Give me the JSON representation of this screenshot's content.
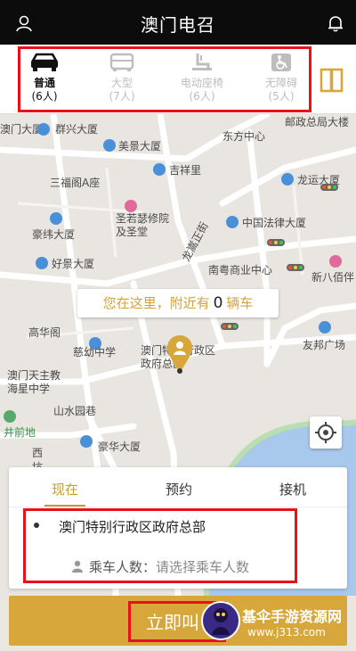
{
  "header": {
    "title": "澳门电召",
    "left_icon": "user-icon",
    "right_icon": "bell-icon"
  },
  "vehicle_types": [
    {
      "name": "普通",
      "capacity": "(6人)",
      "icon": "sedan-icon",
      "active": true
    },
    {
      "name": "大型",
      "capacity": "(7人)",
      "icon": "van-icon",
      "active": false
    },
    {
      "name": "电动座椅",
      "capacity": "(6人)",
      "icon": "power-seat-icon",
      "active": false
    },
    {
      "name": "无障碍",
      "capacity": "(5人)",
      "icon": "wheelchair-icon",
      "active": false
    }
  ],
  "map": {
    "labels": [
      "澳门大厦",
      "群兴大厦",
      "邮政总局大楼",
      "美景大厦",
      "东方中心",
      "吉祥里",
      "三福阁A座",
      "龙运大厦",
      "圣若瑟修院及圣堂",
      "龙嵩正街",
      "中国法律大厦",
      "豪纬大厦",
      "好景大厦",
      "南粤商业中心",
      "新八佰伴",
      "高华阁",
      "慈幼中学",
      "友邦广场",
      "澳门天主教海星中学",
      "山水园巷",
      "井前地",
      "豪华大厦",
      "西坑"
    ],
    "building_label": "澳门特别行政区政府总部",
    "nearby_prefix": "您在这里，附近有",
    "nearby_count": "0",
    "nearby_suffix": "辆车"
  },
  "panel": {
    "tabs": [
      "现在",
      "预约",
      "接机"
    ],
    "active_tab": "现在",
    "destination": "澳门特别行政区政府总部",
    "passenger_label": "乘车人数：",
    "passenger_placeholder": "请选择乘车人数"
  },
  "call_button": {
    "label": "立即叫"
  },
  "watermark": {
    "title": "基伞手游资源网",
    "url": "www.j313.com"
  },
  "colors": {
    "accent": "#d8a73b",
    "header_bg": "#0c0c0c",
    "highlight_red": "#e8101b",
    "water": "#a8c8ec"
  }
}
